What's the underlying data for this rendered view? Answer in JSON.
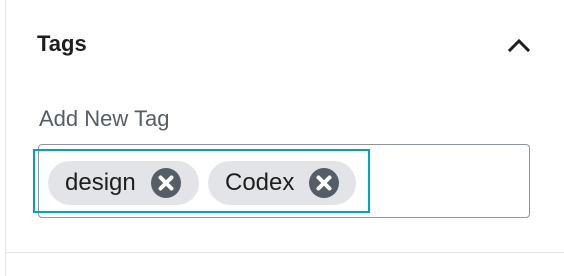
{
  "panel": {
    "title": "Tags",
    "toggle_icon": "chevron-up-icon"
  },
  "field": {
    "label": "Add New Tag",
    "tokens": [
      {
        "label": "design",
        "remove_icon": "dismiss-icon"
      },
      {
        "label": "Codex",
        "remove_icon": "dismiss-icon"
      }
    ]
  },
  "colors": {
    "focus_ring": "#00a0d2",
    "token_bg": "#e2e4e7",
    "remove_icon": "#555d66"
  }
}
